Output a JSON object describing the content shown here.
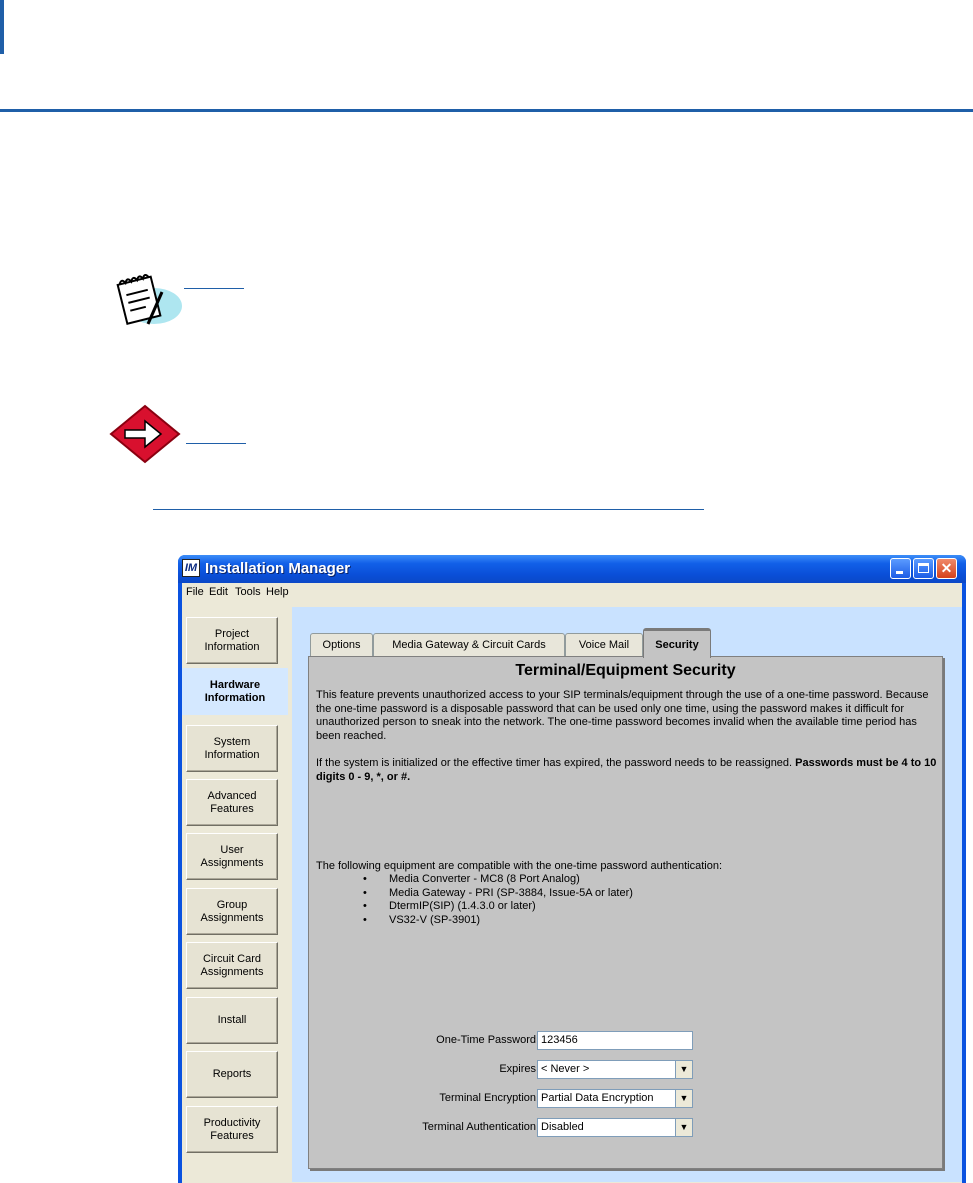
{
  "window": {
    "title": "Installation Manager",
    "logo_text": "IM",
    "controls": {
      "minimize": "minimize",
      "maximize": "maximize",
      "close": "close"
    }
  },
  "menu": [
    "File",
    "Edit",
    "Tools",
    "Help"
  ],
  "sidebar": {
    "items": [
      {
        "label": "Project\nInformation"
      },
      {
        "label": "Hardware\nInformation",
        "active": true
      },
      {
        "label": "System\nInformation"
      },
      {
        "label": "Advanced\nFeatures"
      },
      {
        "label": "User\nAssignments"
      },
      {
        "label": "Group\nAssignments"
      },
      {
        "label": "Circuit Card\nAssignments"
      },
      {
        "label": "Install"
      },
      {
        "label": "Reports"
      },
      {
        "label": "Productivity\nFeatures"
      }
    ]
  },
  "tabs": [
    {
      "label": "Options"
    },
    {
      "label": "Media Gateway & Circuit Cards"
    },
    {
      "label": "Voice Mail"
    },
    {
      "label": "Security",
      "active": true
    }
  ],
  "panel": {
    "title": "Terminal/Equipment Security",
    "para1": "This feature prevents unauthorized access to your SIP terminals/equipment through the use of a one-time password. Because the one-time password is a disposable password that can be used only one time, using the password makes it difficult for unauthorized person to sneak into the network. The one-time password becomes invalid when the available time period has been reached.",
    "para2_normal": "If the system is initialized or the effective timer has expired, the password needs to be reassigned. ",
    "para2_bold": "Passwords must be 4 to 10 digits 0 - 9, *, or #.",
    "para3": "The following equipment are compatible with the one-time password authentication:",
    "equipment": [
      "Media Converter - MC8 (8 Port Analog)",
      "Media Gateway - PRI (SP-3884, Issue-5A or later)",
      "DtermIP(SIP) (1.4.3.0 or later)",
      "VS32-V (SP-3901)"
    ]
  },
  "form": {
    "password_label": "One-Time Password",
    "password_value": "123456",
    "expires_label": "Expires",
    "expires_value": "< Never >",
    "encryption_label": "Terminal Encryption",
    "encryption_value": "Partial Data Encryption",
    "authentication_label": "Terminal Authentication",
    "authentication_value": "Disabled"
  },
  "colors": {
    "doc_accent": "#1f5fa8",
    "titlebar": "#0a52e0",
    "panel_blue": "#c9e2ff",
    "panel_gray": "#c4c4c4",
    "active_tab_accent": "#f5a623"
  }
}
